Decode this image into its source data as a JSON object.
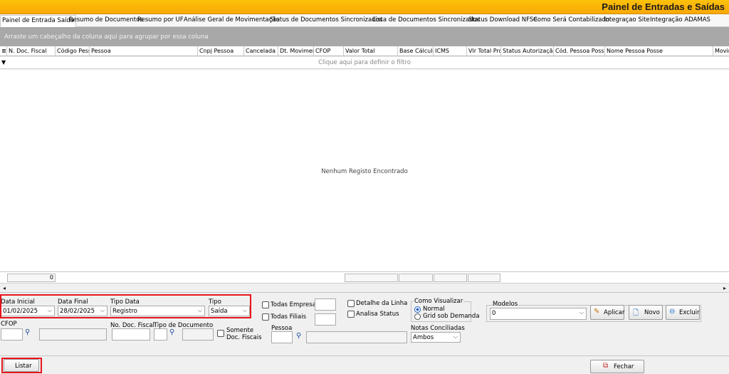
{
  "window": {
    "title": "Painel de Entradas e Saídas"
  },
  "tabs": [
    "Painel de Entrada Saída",
    "Resumo de Documentos",
    "Resumo por UF",
    "Análise Geral de Movimentação",
    "Status de Documentos Sincronizados",
    "Lista de Documentos Sincronizados",
    "Status Download NFSe",
    "Como Será Contabilizado",
    "Integraçao Site",
    "Integração ADAMAS"
  ],
  "grid": {
    "group_hint": "Arraste um cabeçalho da coluna aqui para agrupar por essa coluna",
    "columns": [
      "N. Doc. Fiscal",
      "Código Pess",
      "Pessoa",
      "Cnpj Pessoa",
      "Cancelada",
      "Dt. Movimen",
      "CFOP",
      "Valor Total",
      "Base Cálculo",
      "ICMS",
      "Vlr Total Pro",
      "Status Autorização",
      "Cód. Pessoa Posse",
      "Nome Pessoa Posse",
      "Movim"
    ],
    "filter_hint": "Clique aqui para definir o filtro",
    "empty_message": "Nenhum Registo Encontrado",
    "footer_count": "0"
  },
  "filters": {
    "data_inicial": {
      "label": "Data Inicial",
      "value": "01/02/2025"
    },
    "data_final": {
      "label": "Data Final",
      "value": "28/02/2025"
    },
    "tipo_data": {
      "label": "Tipo Data",
      "value": "Registro"
    },
    "tipo": {
      "label": "Tipo",
      "value": "Saída"
    },
    "todas_empresas": {
      "label": "Todas Empresas",
      "checked": false
    },
    "todas_filiais": {
      "label": "Todas Filiais",
      "checked": false
    },
    "detalhe_linha": {
      "label": "Detalhe da Linha",
      "checked": false
    },
    "analisa_status": {
      "label": "Analisa Status",
      "checked": false
    },
    "como_visualizar": {
      "label": "Como Visualizar",
      "options": [
        "Normal",
        "Grid sob Demanda"
      ],
      "selected": "Normal"
    },
    "modelos": {
      "label": "Modelos",
      "value": "0"
    },
    "cfop": {
      "label": "CFOP"
    },
    "no_doc_fiscal": {
      "label": "No. Doc. Fiscal"
    },
    "tipo_documento": {
      "label": "Tipo de Documento"
    },
    "somente_doc_fiscais": {
      "label_line1": "Somente",
      "label_line2": "Doc. Fiscais",
      "checked": false
    },
    "pessoa": {
      "label": "Pessoa"
    },
    "notas_conciliadas": {
      "label": "Notas Conciliadas",
      "value": "Ambos"
    }
  },
  "buttons": {
    "aplicar": {
      "label": "Aplicar",
      "icon": "pencil-icon"
    },
    "novo": {
      "label": "Novo",
      "icon": "document-icon"
    },
    "excluir": {
      "label": "Excluir",
      "icon": "delete-icon"
    },
    "listar": {
      "label": "Listar"
    },
    "fechar": {
      "label": "Fechar",
      "icon": "close-window-icon"
    }
  },
  "colors": {
    "title_bar": "#fbb607",
    "highlight": "#e8141c",
    "accent_blue": "#1d4f9c"
  }
}
